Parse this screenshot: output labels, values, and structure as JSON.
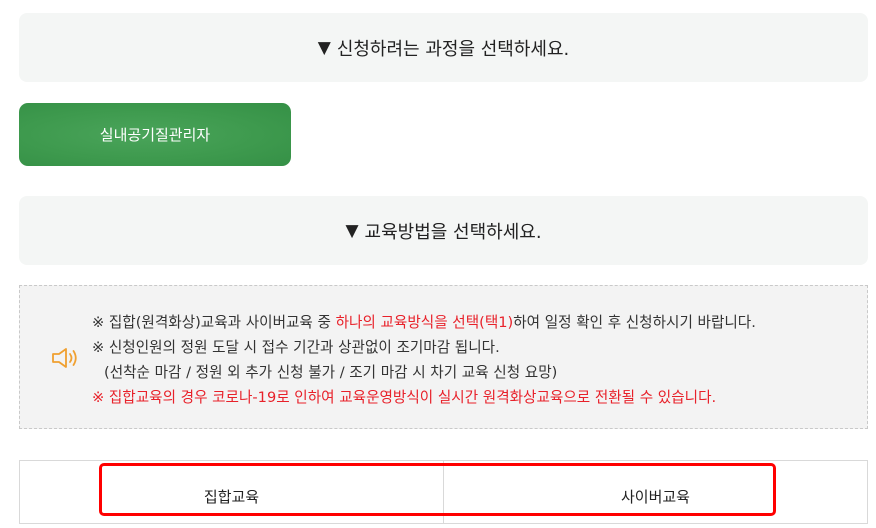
{
  "course_header": {
    "arrow": "▼",
    "text": "신청하려는 과정을 선택하세요."
  },
  "course_button": {
    "label": "실내공기질관리자"
  },
  "method_header": {
    "arrow": "▼",
    "text": "교육방법을 선택하세요."
  },
  "notice": {
    "icon": "speaker-icon",
    "accent_color": "#e8212a",
    "line1_prefix": "※ 집합(원격화상)교육과 사이버교육 중 ",
    "line1_red": "하나의 교육방식을 선택(택1)",
    "line1_suffix": "하여 일정 확인 후 신청하시기 바랍니다.",
    "line2": "※ 신청인원의 정원 도달 시 접수 기간과 상관없이 조기마감 됩니다.",
    "line3": "(선착순 마감 / 정원 외 추가 신청 불가 / 조기 마감 시 차기 교육 신청 요망)",
    "line4": "※ 집합교육의 경우 코로나-19로 인하여 교육운영방식이 실시간 원격화상교육으로 전환될 수 있습니다."
  },
  "methods": [
    {
      "label": "집합교육"
    },
    {
      "label": "사이버교육"
    }
  ],
  "colors": {
    "course_button": "#3e9a4e",
    "highlight": "#ff0000",
    "header_bg": "#f4f6f5"
  }
}
